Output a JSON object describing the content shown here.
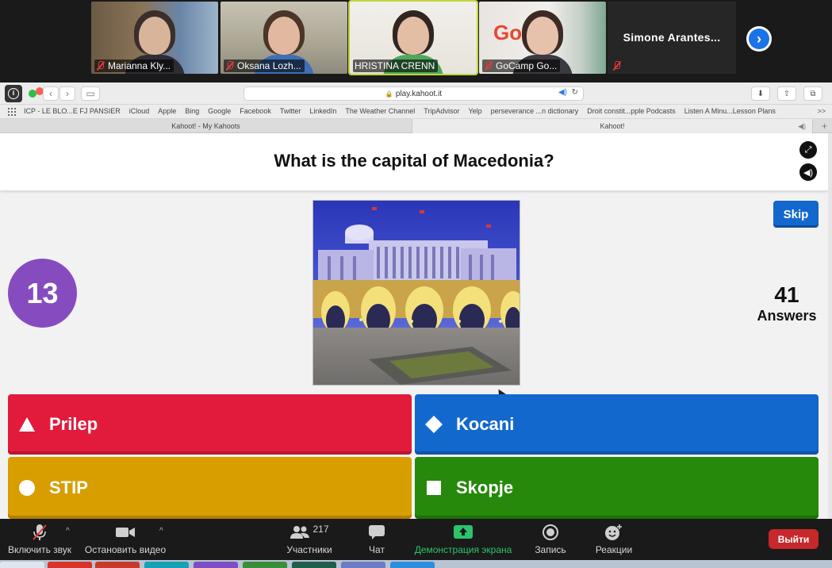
{
  "gallery": {
    "participants": [
      {
        "name": "Marianna Kly...",
        "muted": true
      },
      {
        "name": "Oksana Lozh...",
        "muted": true
      },
      {
        "name": "HRISTINA CRENN",
        "muted": false
      },
      {
        "name": "GoCamp Go...",
        "muted": true
      }
    ],
    "name_only_tile": "Simone Arantes...",
    "next_icon": "chevron-right-icon"
  },
  "browser": {
    "url": "play.kahoot.it",
    "bookmarks": [
      "ICP - LE BLO...E FJ PANSIER",
      "iCloud",
      "Apple",
      "Bing",
      "Google",
      "Facebook",
      "Twitter",
      "LinkedIn",
      "The Weather Channel",
      "TripAdvisor",
      "Yelp",
      "perseverance ...n dictionary",
      "Droit constit...pple Podcasts",
      "Listen A Minu...Lesson Plans"
    ],
    "bookmarks_more": ">>",
    "tabs": [
      {
        "label": "Kahoot! - My Kahoots",
        "active": false
      },
      {
        "label": "Kahoot!",
        "active": true
      }
    ]
  },
  "kahoot": {
    "question": "What is the capital of Macedonia?",
    "skip_label": "Skip",
    "timer": "13",
    "answers_count": "41",
    "answers_label": "Answers",
    "options": [
      {
        "label": "Prilep",
        "shape": "triangle",
        "color": "#e21b3c"
      },
      {
        "label": "Kocani",
        "shape": "diamond",
        "color": "#1368ce"
      },
      {
        "label": "STIP",
        "shape": "circle",
        "color": "#d89e00"
      },
      {
        "label": "Skopje",
        "shape": "square",
        "color": "#26890c"
      }
    ]
  },
  "zoom_bar": {
    "mute_label": "Включить звук",
    "video_label": "Остановить видео",
    "participants_label": "Участники",
    "participants_count": "217",
    "chat_label": "Чат",
    "share_label": "Демонстрация экрана",
    "record_label": "Запись",
    "reactions_label": "Реакции",
    "leave_label": "Выйти"
  },
  "colors": {
    "timer_purple": "#864cbf",
    "skip_blue": "#1368ce",
    "leave_red": "#c6282b",
    "share_green": "#2cc46b"
  }
}
